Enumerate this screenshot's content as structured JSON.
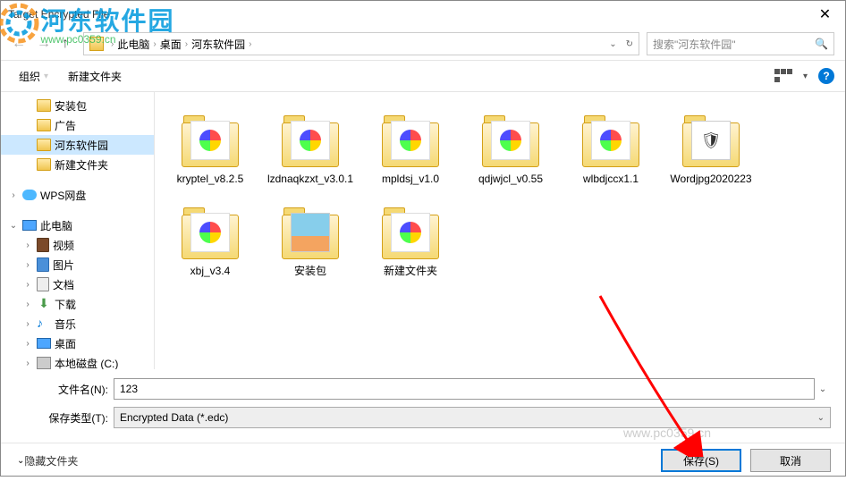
{
  "window": {
    "title": "Target Encrypted File"
  },
  "watermark": {
    "name": "河东软件园",
    "url": "www.pc0359.cn"
  },
  "nav": {
    "back": "←",
    "forward": "→",
    "up": "↑"
  },
  "breadcrumb": {
    "seg1": "此电脑",
    "seg2": "桌面",
    "seg3": "河东软件园",
    "sep": "›"
  },
  "search": {
    "placeholder": "搜索\"河东软件园\""
  },
  "toolbar": {
    "organize": "组织",
    "newfolder": "新建文件夹"
  },
  "sidebar": {
    "items": [
      {
        "label": "安装包",
        "type": "folder",
        "indent": "indent-1"
      },
      {
        "label": "广告",
        "type": "folder",
        "indent": "indent-1"
      },
      {
        "label": "河东软件园",
        "type": "folder",
        "indent": "indent-1",
        "selected": true
      },
      {
        "label": "新建文件夹",
        "type": "folder",
        "indent": "indent-1"
      },
      {
        "label": "WPS网盘",
        "type": "cloud",
        "indent": "",
        "caret": "›"
      },
      {
        "label": "此电脑",
        "type": "pc",
        "indent": "",
        "caret": "⌄"
      },
      {
        "label": "视频",
        "type": "video",
        "indent": "indent-2",
        "caret": "›"
      },
      {
        "label": "图片",
        "type": "pic",
        "indent": "indent-2",
        "caret": "›"
      },
      {
        "label": "文档",
        "type": "doc",
        "indent": "indent-2",
        "caret": "›"
      },
      {
        "label": "下载",
        "type": "dl",
        "indent": "indent-2",
        "caret": "›"
      },
      {
        "label": "音乐",
        "type": "music",
        "indent": "indent-2",
        "caret": "›"
      },
      {
        "label": "桌面",
        "type": "desktop",
        "indent": "indent-2",
        "caret": "›"
      },
      {
        "label": "本地磁盘 (C:)",
        "type": "disk",
        "indent": "indent-2",
        "caret": "›"
      }
    ]
  },
  "files": [
    {
      "name": "kryptel_v8.2.5",
      "type": "pinwheel"
    },
    {
      "name": "lzdnaqkzxt_v3.0.1",
      "type": "pinwheel"
    },
    {
      "name": "mpldsj_v1.0",
      "type": "pinwheel"
    },
    {
      "name": "qdjwjcl_v0.55",
      "type": "pinwheel"
    },
    {
      "name": "wlbdjccx1.1",
      "type": "pinwheel"
    },
    {
      "name": "Wordjpg2020223",
      "type": "doc"
    },
    {
      "name": "xbj_v3.4",
      "type": "pinwheel"
    },
    {
      "name": "安装包",
      "type": "pic"
    },
    {
      "name": "新建文件夹",
      "type": "pinwheel"
    }
  ],
  "fields": {
    "filename_label": "文件名(N):",
    "filename_value": "123",
    "filetype_label": "保存类型(T):",
    "filetype_value": "Encrypted Data (*.edc)"
  },
  "actions": {
    "hide": "隐藏文件夹",
    "save": "保存(S)",
    "cancel": "取消"
  }
}
